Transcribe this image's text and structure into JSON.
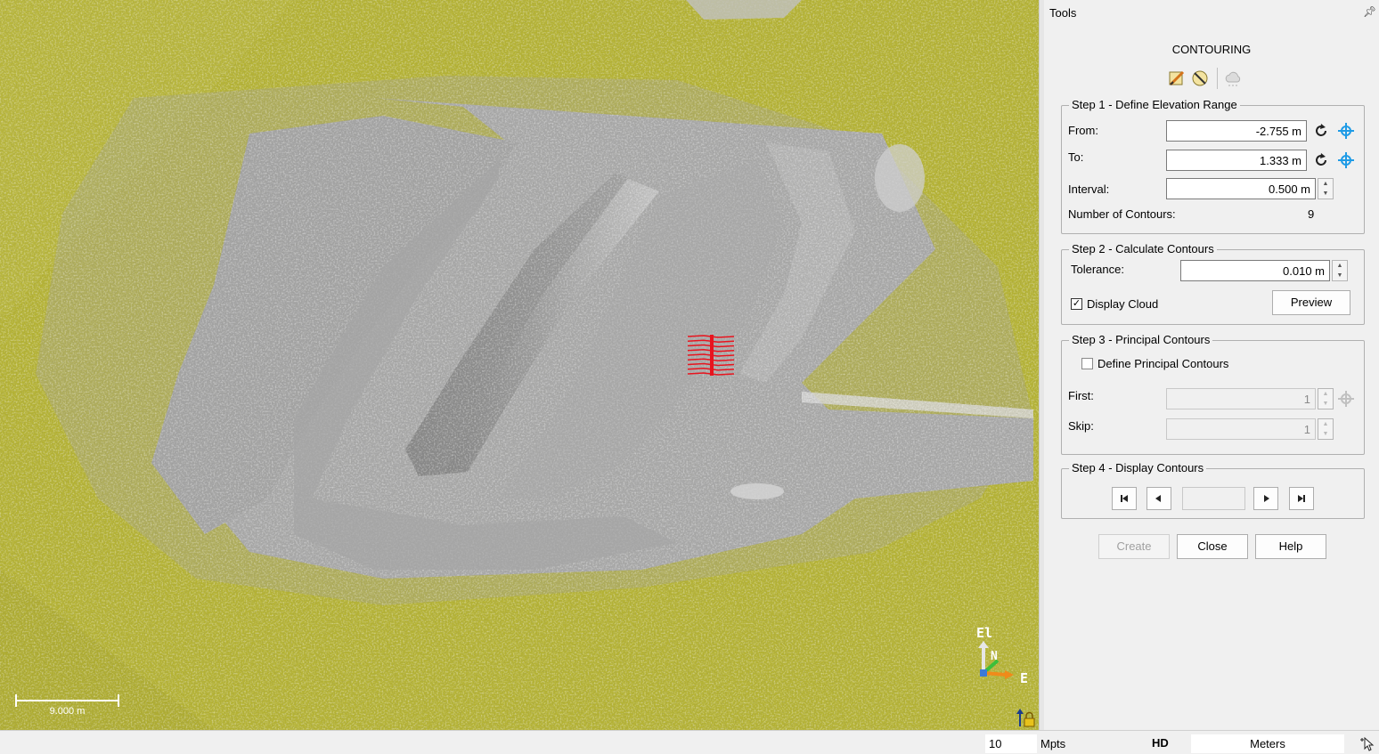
{
  "viewport": {
    "scale_bar_label": "9.000 m",
    "axis_elevation_label": "El",
    "axis_north_label": "N",
    "axis_east_label": "E"
  },
  "panel": {
    "title": "Tools",
    "heading": "CONTOURING",
    "step1": {
      "legend": "Step 1 - Define Elevation Range",
      "from_label": "From:",
      "from_value": "-2.755 m",
      "to_label": "To:",
      "to_value": "1.333 m",
      "interval_label": "Interval:",
      "interval_value": "0.500 m",
      "count_label": "Number of Contours:",
      "count_value": "9"
    },
    "step2": {
      "legend": "Step 2 - Calculate Contours",
      "tolerance_label": "Tolerance:",
      "tolerance_value": "0.010 m",
      "display_cloud_label": "Display Cloud",
      "preview_label": "Preview"
    },
    "step3": {
      "legend": "Step 3 - Principal Contours",
      "define_label": "Define Principal Contours",
      "first_label": "First:",
      "first_value": "1",
      "skip_label": "Skip:",
      "skip_value": "1"
    },
    "step4": {
      "legend": "Step 4 - Display Contours",
      "current_value": ""
    },
    "buttons": {
      "create": "Create",
      "close": "Close",
      "help": "Help"
    }
  },
  "statusbar": {
    "points_value": "10",
    "points_unit": "Mpts",
    "quality": "HD",
    "units": "Meters"
  },
  "colors": {
    "terrain_yellow": "#b4b233",
    "surface_gray": "#a6a6a6",
    "contour_red": "#e8141e",
    "accent_blue": "#1e9be6"
  }
}
